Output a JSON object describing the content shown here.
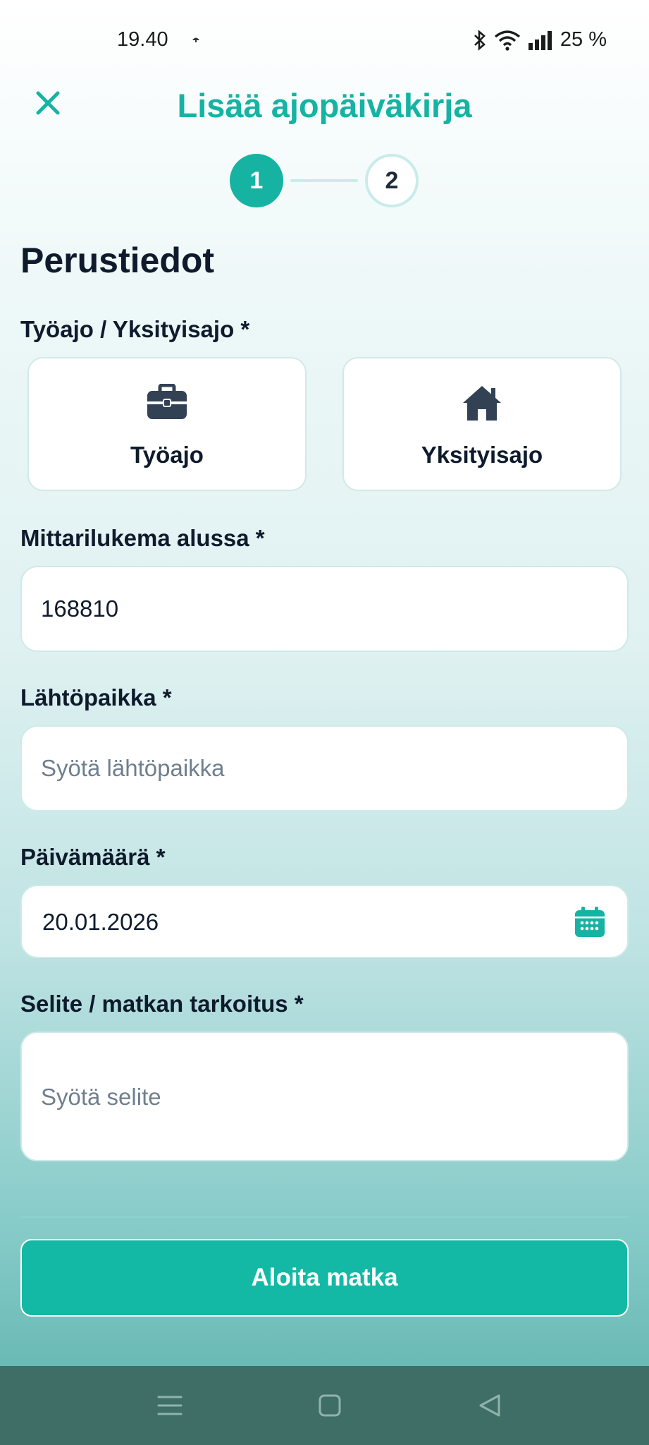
{
  "status_bar": {
    "time": "19.40",
    "battery": "25 %"
  },
  "header": {
    "title": "Lisää ajopäiväkirja"
  },
  "stepper": {
    "step1": "1",
    "step2": "2"
  },
  "section_title": "Perustiedot",
  "trip_type": {
    "label": "Työajo / Yksityisajo *",
    "work_label": "Työajo",
    "private_label": "Yksityisajo"
  },
  "odometer": {
    "label": "Mittarilukema alussa *",
    "value": "168810"
  },
  "departure": {
    "label": "Lähtöpaikka *",
    "placeholder": "Syötä lähtöpaikka"
  },
  "date": {
    "label": "Päivämäärä *",
    "value": "20.01.2026"
  },
  "description": {
    "label": "Selite / matkan tarkoitus *",
    "placeholder": "Syötä selite"
  },
  "start_button": "Aloita matka",
  "colors": {
    "accent": "#16b3a3",
    "button": "#14b9a6",
    "navbar": "#3f6e66"
  }
}
